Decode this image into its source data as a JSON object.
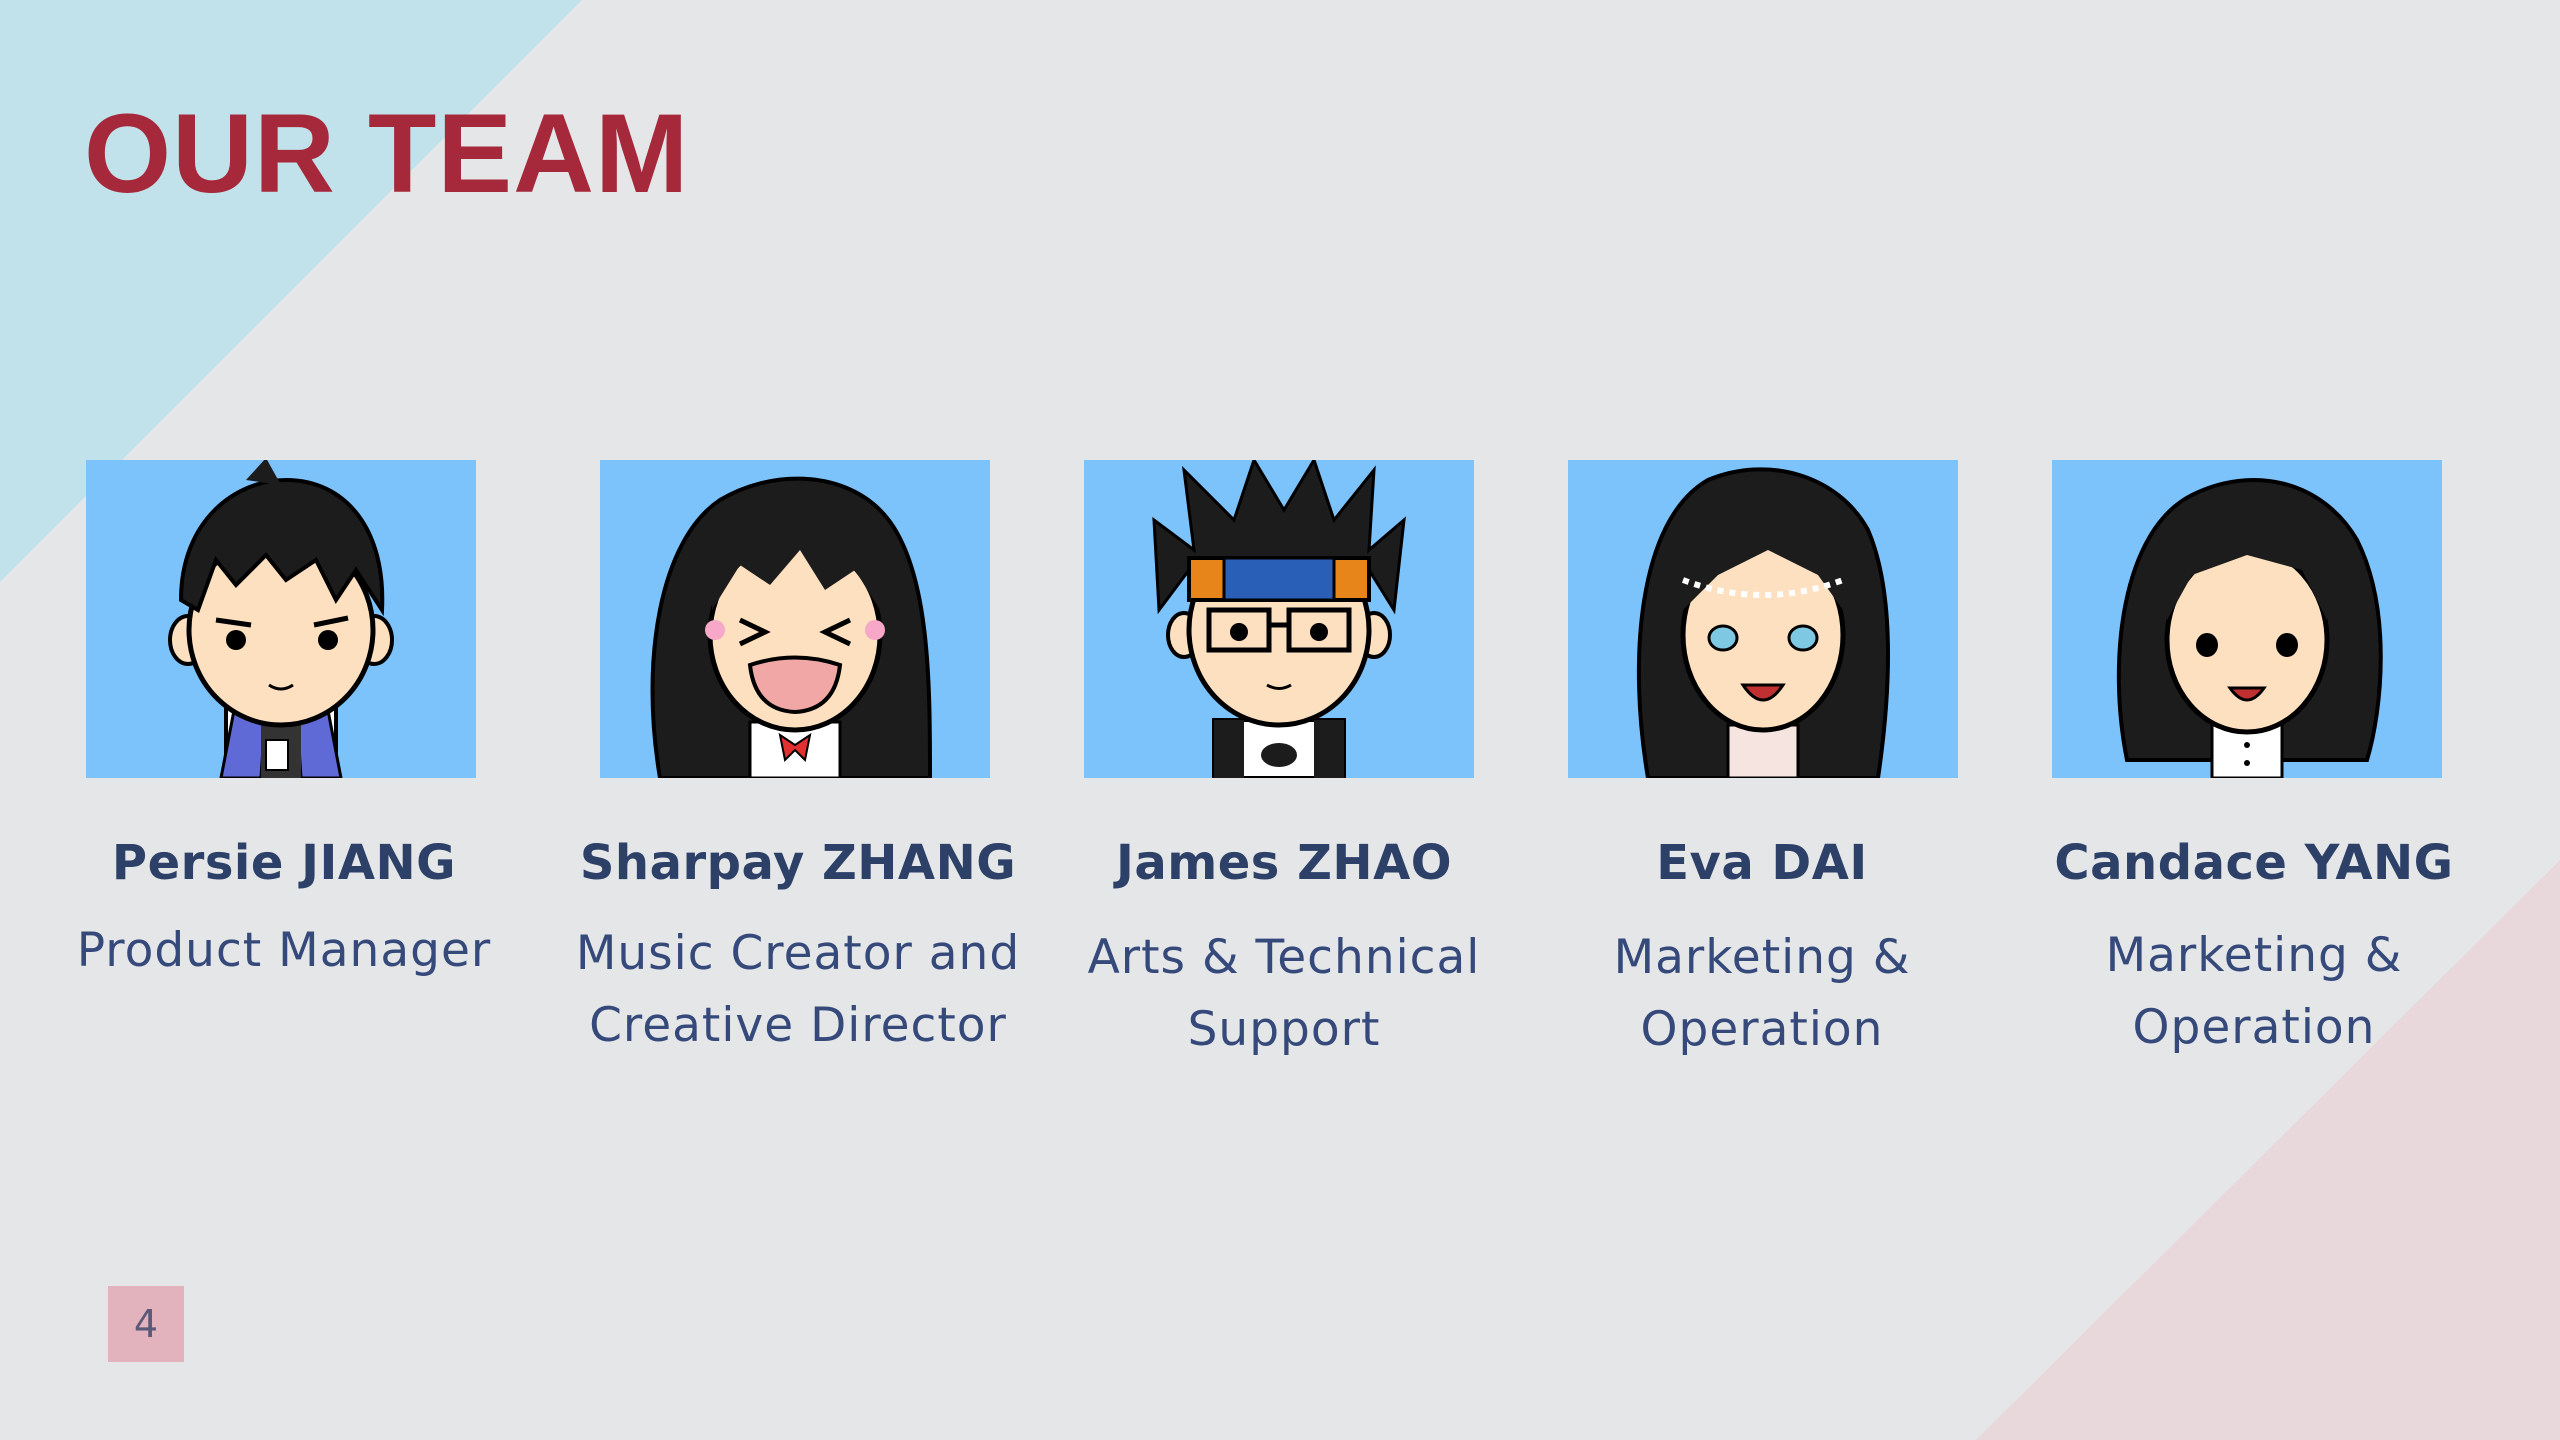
{
  "slide": {
    "title": "OUR TEAM",
    "page_number": "4"
  },
  "colors": {
    "background": "#e5e6e8",
    "title": "#a6283b",
    "name": "#2c4068",
    "role": "#35497a",
    "portrait_bg": "#7cc2fb",
    "stripe_blue": "#c1e2ea",
    "stripe_pink": "#e8d8db",
    "badge": "#e3b3bd"
  },
  "team": [
    {
      "name": "Persie JIANG",
      "role_lines": [
        "Product Manager"
      ],
      "avatar": "boy-avatar-icon"
    },
    {
      "name": "Sharpay ZHANG",
      "role_lines": [
        "Music Creator and",
        "Creative Director"
      ],
      "avatar": "laughing-girl-avatar-icon"
    },
    {
      "name": "James ZHAO",
      "role_lines": [
        "Arts & Technical",
        "Support"
      ],
      "avatar": "ninja-headband-avatar-icon"
    },
    {
      "name": "Eva DAI",
      "role_lines": [
        "Marketing &",
        "Operation"
      ],
      "avatar": "tiara-girl-avatar-icon"
    },
    {
      "name": "Candace YANG",
      "role_lines": [
        "Marketing &",
        "Operation"
      ],
      "avatar": "short-hair-girl-avatar-icon"
    }
  ]
}
